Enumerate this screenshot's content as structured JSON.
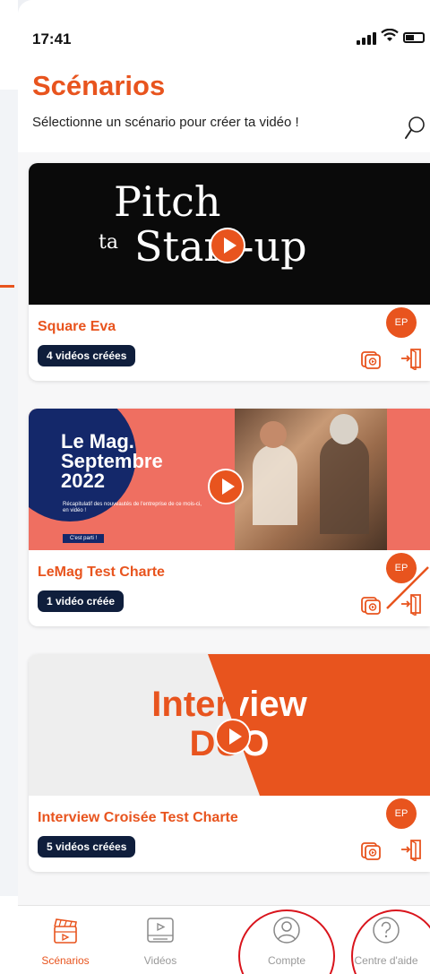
{
  "status_bar": {
    "time": "17:41"
  },
  "header": {
    "title": "Scénarios",
    "subtitle": "Sélectionne un scénario pour créer ta vidéo !"
  },
  "cards": [
    {
      "title": "Square Eva",
      "badge": "4 vidéos créées",
      "avatar": "EP",
      "thumb": {
        "line1": "Pitch",
        "line2_small": "ta",
        "line2": "Start-up"
      }
    },
    {
      "title": "LeMag Test Charte",
      "badge": "1 vidéo créée",
      "avatar": "EP",
      "thumb": {
        "line1": "Le Mag.",
        "line2": "Septembre",
        "line3": "2022",
        "caption": "Récapitulatif des nouveautés de l'entreprise de ce mois-ci, en vidéo !",
        "button": "C'est parti !"
      }
    },
    {
      "title": "Interview Croisée Test Charte",
      "badge": "5 vidéos créées",
      "avatar": "EP",
      "thumb": {
        "line1": "Interview",
        "line2": "DUO"
      }
    }
  ],
  "tabs": [
    {
      "label": "Scénarios",
      "icon": "clapperboard-icon",
      "active": true
    },
    {
      "label": "Vidéos",
      "icon": "video-screen-icon",
      "active": false
    },
    {
      "label": "Compte",
      "icon": "user-icon",
      "active": false
    },
    {
      "label": "Centre d'aide",
      "icon": "help-icon",
      "active": false
    }
  ],
  "colors": {
    "accent": "#e8541e",
    "badge": "#0f1e3c",
    "highlight": "#d9141c"
  }
}
